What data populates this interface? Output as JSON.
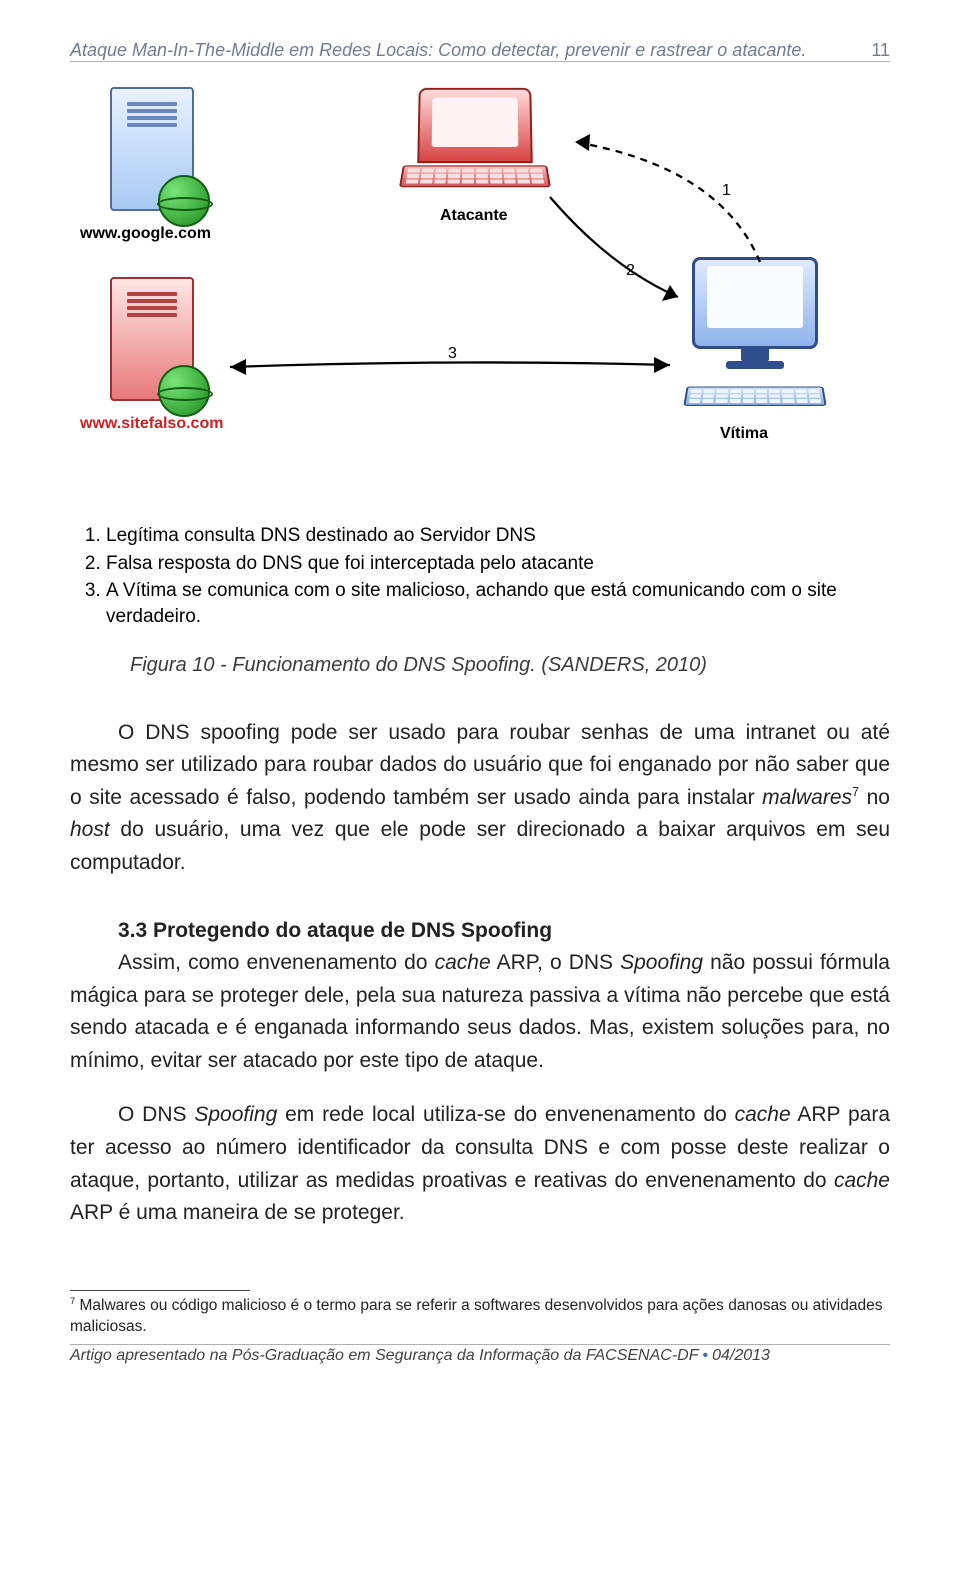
{
  "header": {
    "title": "Ataque Man-In-The-Middle em Redes Locais: Como detectar, prevenir e rastrear o atacante.",
    "page_number": "11"
  },
  "figure": {
    "labels": {
      "google": "www.google.com",
      "sitefalso": "www.sitefalso.com",
      "atacante": "Atacante",
      "vitima": "Vítima",
      "n1": "1",
      "n2": "2",
      "n3": "3"
    },
    "legend": [
      "Legítima consulta DNS destinado ao Servidor DNS",
      "Falsa resposta do DNS que foi interceptada pelo atacante",
      "A Vítima se comunica com o site malicioso, achando que está comunicando com o site verdadeiro."
    ],
    "caption": "Figura 10 - Funcionamento do DNS Spoofing. (SANDERS, 2010)"
  },
  "paragraphs": {
    "p1_a": "O DNS spoofing pode ser usado para roubar senhas de uma intranet ou até mesmo ser utilizado para roubar dados do usuário que foi enganado por não saber que o site acessado é falso, podendo também ser usado ainda para instalar ",
    "p1_b": "malwares",
    "p1_sup": "7",
    "p1_c": " no ",
    "p1_d": "host",
    "p1_e": " do usuário, uma vez que ele pode ser direcionado a baixar arquivos em seu computador.",
    "h_sec": "3.3 Protegendo do ataque de DNS Spoofing",
    "p2_a": "Assim, como envenenamento do ",
    "p2_b": "cache",
    "p2_c": " ARP, o DNS ",
    "p2_d": "Spoofing",
    "p2_e": " não possui fórmula mágica para se proteger dele, pela sua natureza passiva a vítima não percebe que está sendo atacada e é enganada informando seus dados. Mas, existem soluções para, no mínimo, evitar ser atacado por este tipo de ataque.",
    "p3_a": "O DNS ",
    "p3_b": "Spoofing",
    "p3_c": " em rede local utiliza-se do envenenamento do ",
    "p3_d": "cache",
    "p3_e": " ARP para ter acesso ao número identificador da consulta DNS e com posse deste realizar o ataque, portanto, utilizar as medidas proativas e reativas do envenenamento do ",
    "p3_f": "cache",
    "p3_g": " ARP é uma maneira de se proteger."
  },
  "footnote": {
    "marker": "7",
    "text": " Malwares ou código malicioso é o termo para se referir a softwares desenvolvidos para ações danosas ou atividades maliciosas."
  },
  "footer": {
    "left": "Artigo apresentado na Pós-Graduação em Segurança da Informação da FACSENAC-DF",
    "right": "04/2013"
  }
}
